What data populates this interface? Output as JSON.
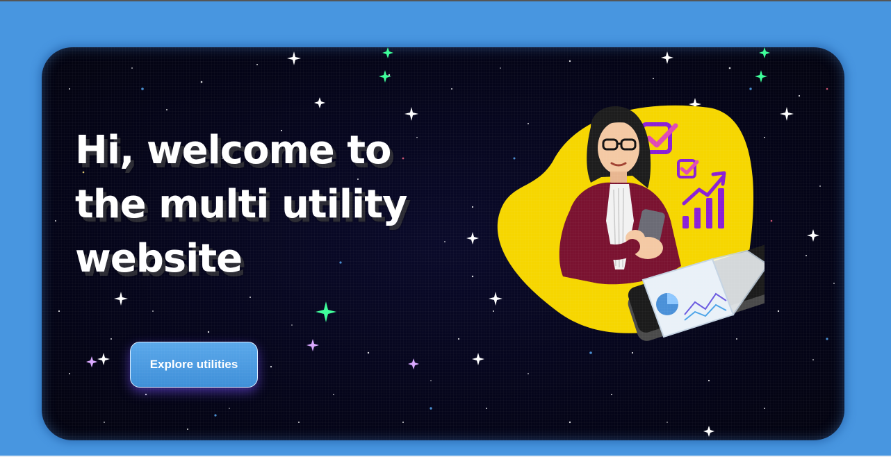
{
  "hero": {
    "headline": "Hi, welcome to the multi utility website",
    "cta_label": "Explore utilities"
  },
  "colors": {
    "page_background": "#4896e0",
    "hero_background": "#05051a",
    "blob_yellow": "#f6d600",
    "cta_blue": "#4a9be2",
    "accent_purple": "#8a1fd6"
  },
  "icons": [
    "star-sparkle-icon",
    "checkbox-icon",
    "growth-chart-icon"
  ]
}
